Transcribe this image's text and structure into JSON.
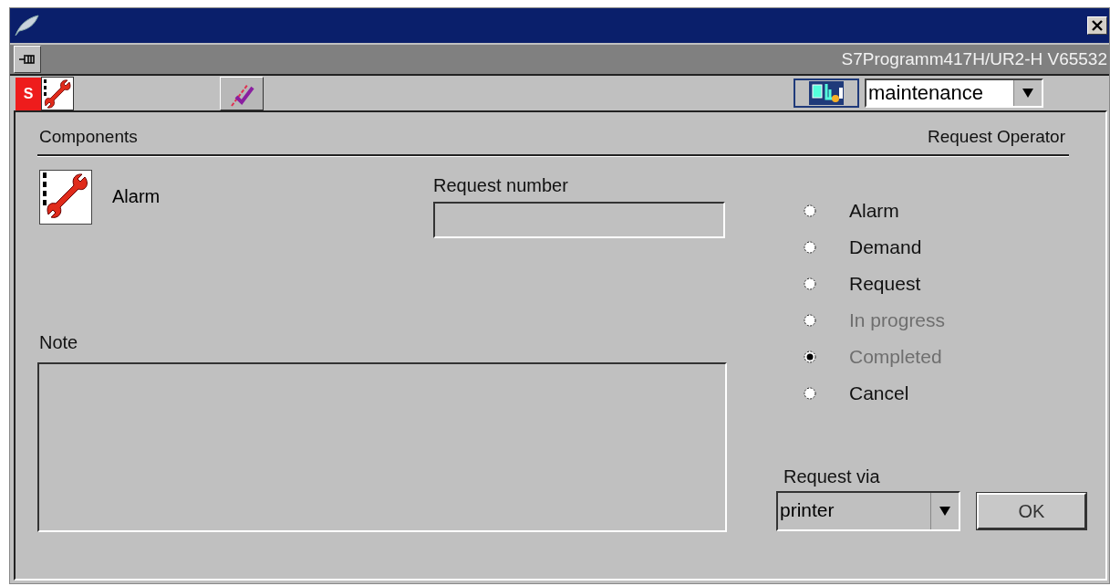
{
  "window": {
    "subtitle": "S7Programm417H/UR2-H V65532"
  },
  "toolbar": {
    "status_badge": "S",
    "view": {
      "value": "maintenance"
    }
  },
  "components": {
    "heading": "Components",
    "items": [
      {
        "label": "Alarm"
      }
    ]
  },
  "request_number": {
    "label": "Request number"
  },
  "note": {
    "label": "Note"
  },
  "request_operator": {
    "heading": "Request Operator",
    "options": [
      {
        "label": "Alarm",
        "selected": false,
        "disabled": false
      },
      {
        "label": "Demand",
        "selected": false,
        "disabled": false
      },
      {
        "label": "Request",
        "selected": false,
        "disabled": false
      },
      {
        "label": "In progress",
        "selected": false,
        "disabled": true
      },
      {
        "label": "Completed",
        "selected": true,
        "disabled": true
      },
      {
        "label": "Cancel",
        "selected": false,
        "disabled": false
      }
    ]
  },
  "request_via": {
    "label": "Request via",
    "value": "printer"
  },
  "buttons": [
    {
      "label": "OK"
    }
  ]
}
